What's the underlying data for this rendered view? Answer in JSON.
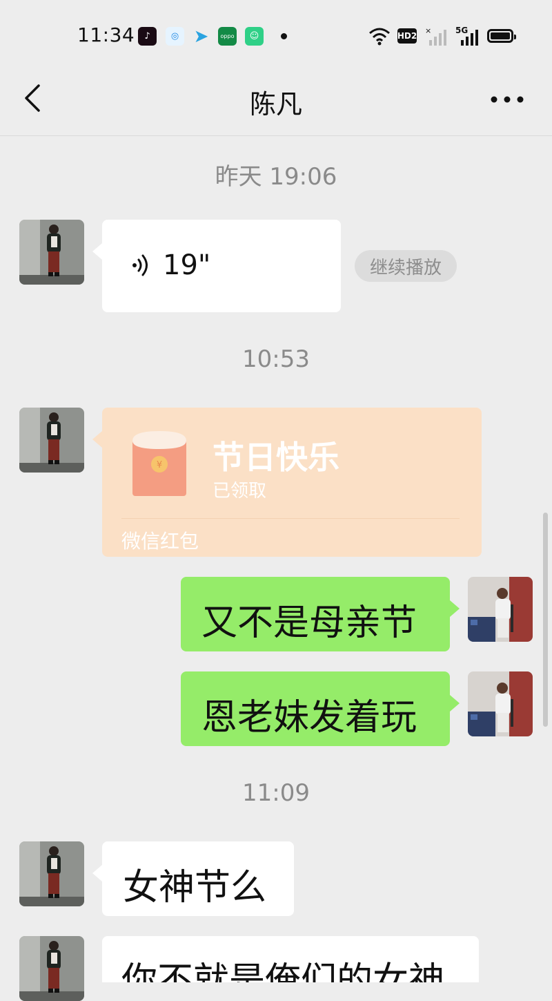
{
  "status_bar": {
    "time": "11:34",
    "apps": [
      {
        "icon": "tiktok-icon",
        "color": "#1a0b14"
      },
      {
        "icon": "browser-icon",
        "color": "#e6f4ff"
      },
      {
        "icon": "telegram-icon",
        "color": "#2aa3e0"
      },
      {
        "icon": "oppo-icon",
        "color": "#138a46",
        "label": "oppo"
      },
      {
        "icon": "store-icon",
        "color": "#2fd087"
      }
    ],
    "hd_label": "HD2",
    "network_label": "5G"
  },
  "nav": {
    "title": "陈凡"
  },
  "messages": [
    {
      "kind": "timestamp",
      "text": "昨天 19:06"
    },
    {
      "kind": "voice",
      "side": "left",
      "duration": "19\"",
      "action": "继续播放"
    },
    {
      "kind": "timestamp",
      "text": "10:53"
    },
    {
      "kind": "red_packet",
      "side": "left",
      "title": "节日快乐",
      "status": "已领取",
      "footer": "微信红包"
    },
    {
      "kind": "text",
      "side": "right",
      "text": "又不是母亲节"
    },
    {
      "kind": "text",
      "side": "right",
      "text": "恩老妹发着玩"
    },
    {
      "kind": "timestamp",
      "text": "11:09"
    },
    {
      "kind": "text",
      "side": "left",
      "text": "女神节么"
    },
    {
      "kind": "text",
      "side": "left",
      "text": "你不就是俺们的女神"
    }
  ],
  "colors": {
    "background": "#ededed",
    "bubble_self": "#95ec69",
    "bubble_other": "#ffffff",
    "red_packet_received": "#fbe0c6"
  }
}
